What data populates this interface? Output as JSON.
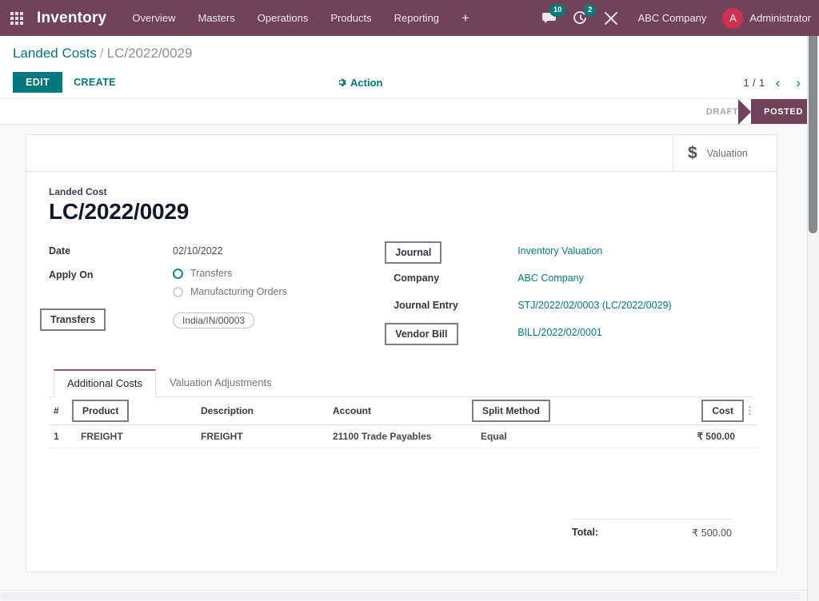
{
  "navbar": {
    "apps_icon": "apps-grid-icon",
    "brand": "Inventory",
    "menu": [
      "Overview",
      "Masters",
      "Operations",
      "Products",
      "Reporting"
    ],
    "plus": "+",
    "messages_icon": "chat-bubble-icon",
    "messages_count": "10",
    "activities_icon": "clock-activity-icon",
    "activities_count": "2",
    "tools_icon": "wrench-icon",
    "company": "ABC Company",
    "user_initial": "A",
    "user_name": "Administrator"
  },
  "control_panel": {
    "breadcrumb_root": "Landed Costs",
    "breadcrumb_sep": "/",
    "breadcrumb_current": "LC/2022/0029",
    "edit_label": "EDIT",
    "create_label": "CREATE",
    "action_label": "Action",
    "action_icon": "gear-icon",
    "pager_text": "1 / 1",
    "prev_icon": "chevron-left-icon",
    "next_icon": "chevron-right-icon"
  },
  "statusbar": {
    "stages": [
      "DRAFT",
      "POSTED"
    ],
    "active": "POSTED"
  },
  "smart_buttons": [
    {
      "icon": "dollar-icon",
      "label": "Valuation"
    }
  ],
  "form": {
    "subtitle": "Landed Cost",
    "title": "LC/2022/0029",
    "left": {
      "date_label": "Date",
      "date_value": "02/10/2022",
      "apply_on_label": "Apply On",
      "radios": [
        {
          "label": "Transfers",
          "selected": true
        },
        {
          "label": "Manufacturing Orders",
          "selected": false
        }
      ],
      "transfers_label": "Transfers",
      "transfers_tag": "India/IN/00003"
    },
    "right": {
      "journal_label": "Journal",
      "journal_value": "Inventory Valuation",
      "company_label": "Company",
      "company_value": "ABC Company",
      "journal_entry_label": "Journal Entry",
      "journal_entry_value": "STJ/2022/02/0003 (LC/2022/0029)",
      "vendor_bill_label": "Vendor Bill",
      "vendor_bill_value": "BILL/2022/02/0001"
    }
  },
  "notebook": {
    "tabs": [
      {
        "label": "Additional Costs",
        "active": true
      },
      {
        "label": "Valuation Adjustments",
        "active": false
      }
    ]
  },
  "table": {
    "columns": [
      "#",
      "Product",
      "Description",
      "Account",
      "Split Method",
      "Cost"
    ],
    "optional_columns_icon": "vertical-dots-icon",
    "rows": [
      {
        "num": "1",
        "product": "FREIGHT",
        "description": "FREIGHT",
        "account": "21100 Trade Payables",
        "split_method": "Equal",
        "cost": "₹ 500.00"
      }
    ],
    "total_label": "Total:",
    "total_value": "₹ 500.00"
  },
  "colors": {
    "navbar": "#71435b",
    "accent_teal": "#00787c",
    "status_active": "#71435b",
    "badge": "#0c7a78",
    "avatar": "#d1304f"
  }
}
